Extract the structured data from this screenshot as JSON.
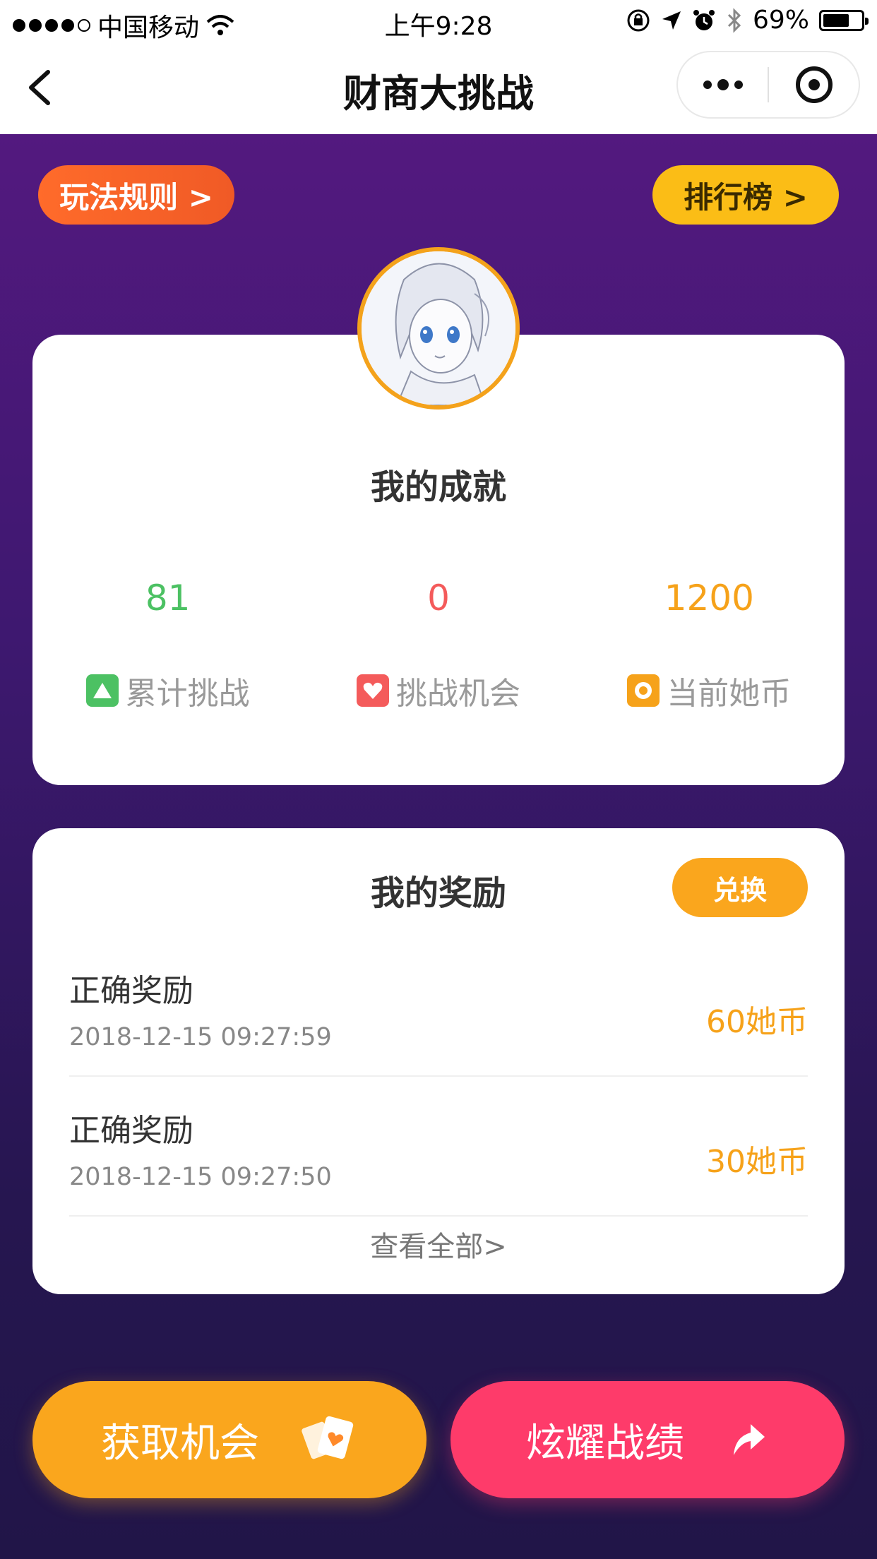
{
  "status_bar": {
    "carrier": "中国移动",
    "time": "上午9:28",
    "battery": "69%"
  },
  "nav": {
    "title": "财商大挑战"
  },
  "top_buttons": {
    "rules": "玩法规则 >",
    "ranking": "排行榜 >"
  },
  "achievements": {
    "title": "我的成就",
    "stats": [
      {
        "value": "81",
        "label": "累计挑战",
        "color": "#4cc163",
        "icon": "triangle-icon"
      },
      {
        "value": "0",
        "label": "挑战机会",
        "color": "#f45b5b",
        "icon": "heart-icon"
      },
      {
        "value": "1200",
        "label": "当前她币",
        "color": "#f6a21a",
        "icon": "coin-icon"
      }
    ]
  },
  "rewards": {
    "title": "我的奖励",
    "exchange": "兑换",
    "items": [
      {
        "name": "正确奖励",
        "time": "2018-12-15 09:27:59",
        "amount": "60她币"
      },
      {
        "name": "正确奖励",
        "time": "2018-12-15 09:27:50",
        "amount": "30她币"
      }
    ],
    "view_all": "查看全部>"
  },
  "actions": {
    "get_chance": "获取机会",
    "show_off": "炫耀战绩"
  }
}
